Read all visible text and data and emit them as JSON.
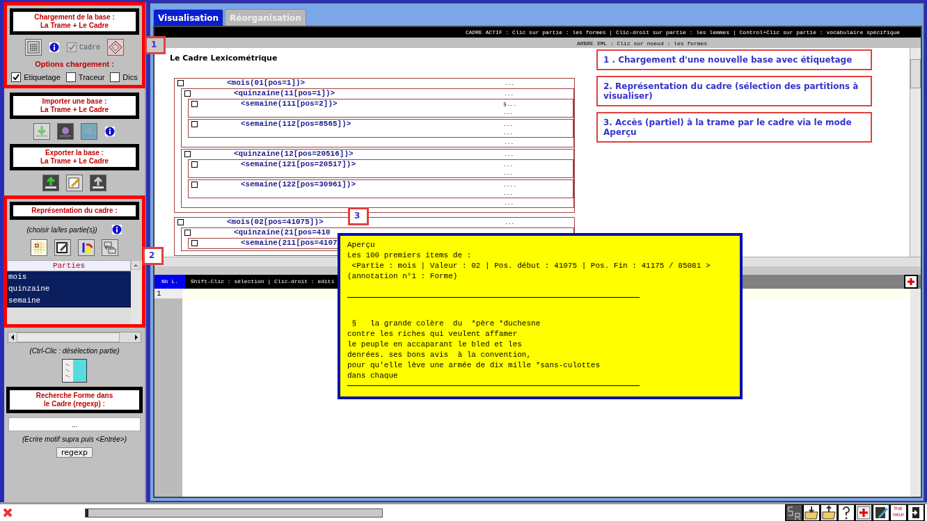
{
  "left_panel": {
    "load_section": {
      "title": [
        "Chargement de la base :",
        "La Trame + Le Cadre"
      ],
      "cadre_checkbox": {
        "label": "Cadre",
        "checked": true
      },
      "options_title": "Options chargement :",
      "options": [
        {
          "label": "Etiquetage",
          "checked": true
        },
        {
          "label": "Traceur",
          "checked": false
        },
        {
          "label": "Dics",
          "checked": false
        }
      ]
    },
    "import_section": {
      "title": [
        "Importer une base :",
        "La Trame + Le Cadre"
      ]
    },
    "export_section": {
      "title": [
        "Exporter la base :",
        "La Trame + Le Cadre"
      ]
    },
    "frame_section": {
      "title": "Représentation du cadre :",
      "hint": "(choisir la/les partie(s))",
      "list_header": "Parties",
      "parts": [
        {
          "label": "mois",
          "selected": true
        },
        {
          "label": "quinzaine",
          "selected": true
        },
        {
          "label": "semaine",
          "selected": true
        }
      ]
    },
    "deselect_hint": "(Ctrl-Clic : désélection partie)",
    "search_section": {
      "title": [
        "Recherche Forme dans",
        "le Cadre (regexp) :"
      ],
      "input_value": "...",
      "hint": "(Ecrire motif supra puis <Entrée>)",
      "button": "regexp"
    }
  },
  "tabs": [
    {
      "label": "Visualisation",
      "selected": true
    },
    {
      "label": "Réorganisation",
      "selected": false
    }
  ],
  "active_frame_bar": "CADRE ACTIF : Clic sur partie : les formes | Clic-droit sur partie : les lemmes | Control+Clic sur partie : vocabulaire spécifique",
  "xml_tree_bar": "ARBRE XML : Clic sur noeud : les formes",
  "tree_title": "Le Cadre Lexicométrique",
  "tree": [
    {
      "label": "<mois(01[pos=1])>",
      "checked": false,
      "dots": [
        "..."
      ],
      "children": [
        {
          "label": "<quinzaine(11[pos=1])>",
          "checked": false,
          "dots": [
            "...",
            "..."
          ],
          "children": [
            {
              "label": "<semaine(111[pos=2])>",
              "checked": false,
              "dots": [
                "§...",
                "..."
              ]
            },
            {
              "label": "<semaine(112[pos=8565])>",
              "checked": false,
              "dots": [
                "...",
                "..."
              ]
            }
          ]
        },
        {
          "label": "<quinzaine(12[pos=20516])>",
          "checked": false,
          "dots": [
            "...",
            "..."
          ],
          "children": [
            {
              "label": "<semaine(121[pos=20517])>",
              "checked": false,
              "dots": [
                "...",
                "..."
              ]
            },
            {
              "label": "<semaine(122[pos=30961])>",
              "checked": false,
              "dots": [
                "....",
                "..."
              ]
            }
          ]
        }
      ]
    },
    {
      "label": "<mois(02[pos=41075])>",
      "checked": false,
      "dots": [
        "..."
      ],
      "children": [
        {
          "label": "<quinzaine(21[pos=410",
          "checked": false,
          "children": [
            {
              "label": "<semaine(211[pos=4107",
              "checked": false
            }
          ]
        }
      ]
    }
  ],
  "callouts": [
    "1 . Chargement d'une nouvelle base avec étiquetage",
    "2. Représentation du cadre (sélection des partitions à visualiser)",
    "3. Accès (partiel) à la trame par le cadre via le mode Aperçu"
  ],
  "markers": [
    "1",
    "2",
    "3"
  ],
  "editor": {
    "line_header": "Nb L.",
    "info_bar": "Shift-Clic : sélection | Clic-droit : editi",
    "line_numbers": [
      "1"
    ]
  },
  "preview_popup": {
    "header_lines": [
      "Aperçu",
      "Les 100 premiers items de :",
      " <Partie : mois | Valeur : 02 | Pos. début : 41075 | Pos. Fin : 41175 / 85081 >",
      "(annotation n°1 : Forme)"
    ],
    "body_lines": [
      " §   la grande colère  du  *père *duchesne",
      "contre les riches qui veulent affamer",
      "le peuple en accaparant le bled et les",
      "denrées. ses bons avis  à la convention,",
      "pour qu'elle lève une armée de dix mille *sans-culottes",
      "dans chaque"
    ]
  },
  "status_bar": {
    "progress": {
      "level": 0.01
    },
    "toolbar": [
      {
        "kind": "sr"
      },
      {
        "kind": "folder-down"
      },
      {
        "kind": "folder-up"
      },
      {
        "kind": "help"
      },
      {
        "kind": "add"
      },
      {
        "kind": "edit"
      },
      {
        "kind": "text",
        "label": "trar neur"
      },
      {
        "kind": "exit"
      }
    ]
  }
}
